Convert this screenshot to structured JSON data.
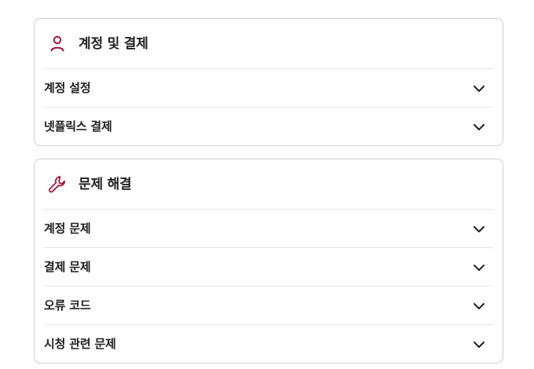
{
  "colors": {
    "accent": "#a8123e",
    "text": "#1f1f1f",
    "border": "#cfcfcf",
    "divider": "#e4e4e4"
  },
  "sections": [
    {
      "icon": "user-icon",
      "title": "계정 및 결제",
      "items": [
        {
          "label": "계정 설정",
          "icon": "chevron-down-icon"
        },
        {
          "label": "넷플릭스 결제",
          "icon": "chevron-down-icon"
        }
      ]
    },
    {
      "icon": "wrench-icon",
      "title": "문제 해결",
      "items": [
        {
          "label": "계정 문제",
          "icon": "chevron-down-icon"
        },
        {
          "label": "결제 문제",
          "icon": "chevron-down-icon"
        },
        {
          "label": "오류 코드",
          "icon": "chevron-down-icon"
        },
        {
          "label": "시청 관련 문제",
          "icon": "chevron-down-icon"
        }
      ]
    }
  ]
}
